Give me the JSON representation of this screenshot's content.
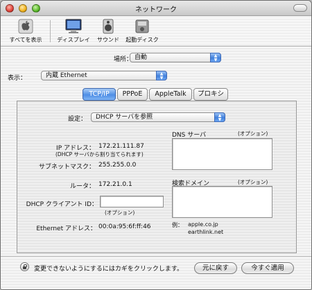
{
  "window": {
    "title": "ネットワーク"
  },
  "toolbar": {
    "items": [
      {
        "label": "すべてを表示",
        "icon": "apple-icon"
      },
      {
        "label": "ディスプレイ",
        "icon": "display-icon"
      },
      {
        "label": "サウンド",
        "icon": "speaker-icon"
      },
      {
        "label": "起動ディスク",
        "icon": "startup-disk-icon"
      }
    ]
  },
  "location": {
    "label": "場所：",
    "value": "自動"
  },
  "show": {
    "label": "表示：",
    "value": "内蔵 Ethernet"
  },
  "tabs": [
    {
      "label": "TCP/IP",
      "active": true
    },
    {
      "label": "PPPoE",
      "active": false
    },
    {
      "label": "AppleTalk",
      "active": false
    },
    {
      "label": "プロキシ",
      "active": false
    }
  ],
  "tcpip": {
    "config_label": "設定：",
    "config_value": "DHCP サーバを参照",
    "ip_label": "IP アドレス：",
    "ip_value": "172.21.111.87",
    "ip_note": "(DHCP サーバから割り当てられます)",
    "subnet_label": "サブネットマスク：",
    "subnet_value": "255.255.0.0",
    "router_label": "ルータ：",
    "router_value": "172.21.0.1",
    "dhcp_client_label": "DHCP クライアント ID：",
    "dhcp_client_value": "",
    "dhcp_client_optional": "(オプション)",
    "ethernet_label": "Ethernet アドレス：",
    "ethernet_value": "00:0a:95:6f:ff:46",
    "dns_label": "DNS サーバ",
    "dns_optional": "(オプション)",
    "search_label": "検索ドメイン",
    "search_optional": "(オプション)",
    "example_label": "例：",
    "example_1": "apple.co.jp",
    "example_2": "earthlink.net"
  },
  "footer": {
    "lock_text": "変更できないようにするにはカギをクリックします。",
    "revert_label": "元に戻す",
    "apply_label": "今すぐ適用"
  },
  "colors": {
    "accent": "#4f8ee6",
    "window_bg": "#ececec"
  }
}
